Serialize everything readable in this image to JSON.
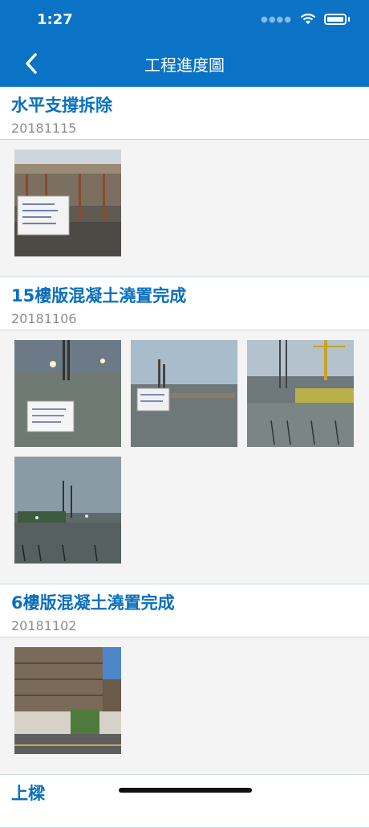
{
  "status": {
    "time": "1:27"
  },
  "nav": {
    "title": "工程進度圖"
  },
  "sections": [
    {
      "title": "水平支撐拆除",
      "date": "20181115",
      "photos": [
        "construction-photo"
      ]
    },
    {
      "title": "15樓版混凝土澆置完成",
      "date": "20181106",
      "photos": [
        "construction-photo",
        "construction-photo",
        "construction-photo",
        "construction-photo"
      ]
    },
    {
      "title": "6樓版混凝土澆置完成",
      "date": "20181102",
      "photos": [
        "construction-photo"
      ]
    },
    {
      "title": "上樑",
      "date": ""
    }
  ],
  "colors": {
    "accent": "#0a73c6",
    "title": "#0a6fbe"
  }
}
